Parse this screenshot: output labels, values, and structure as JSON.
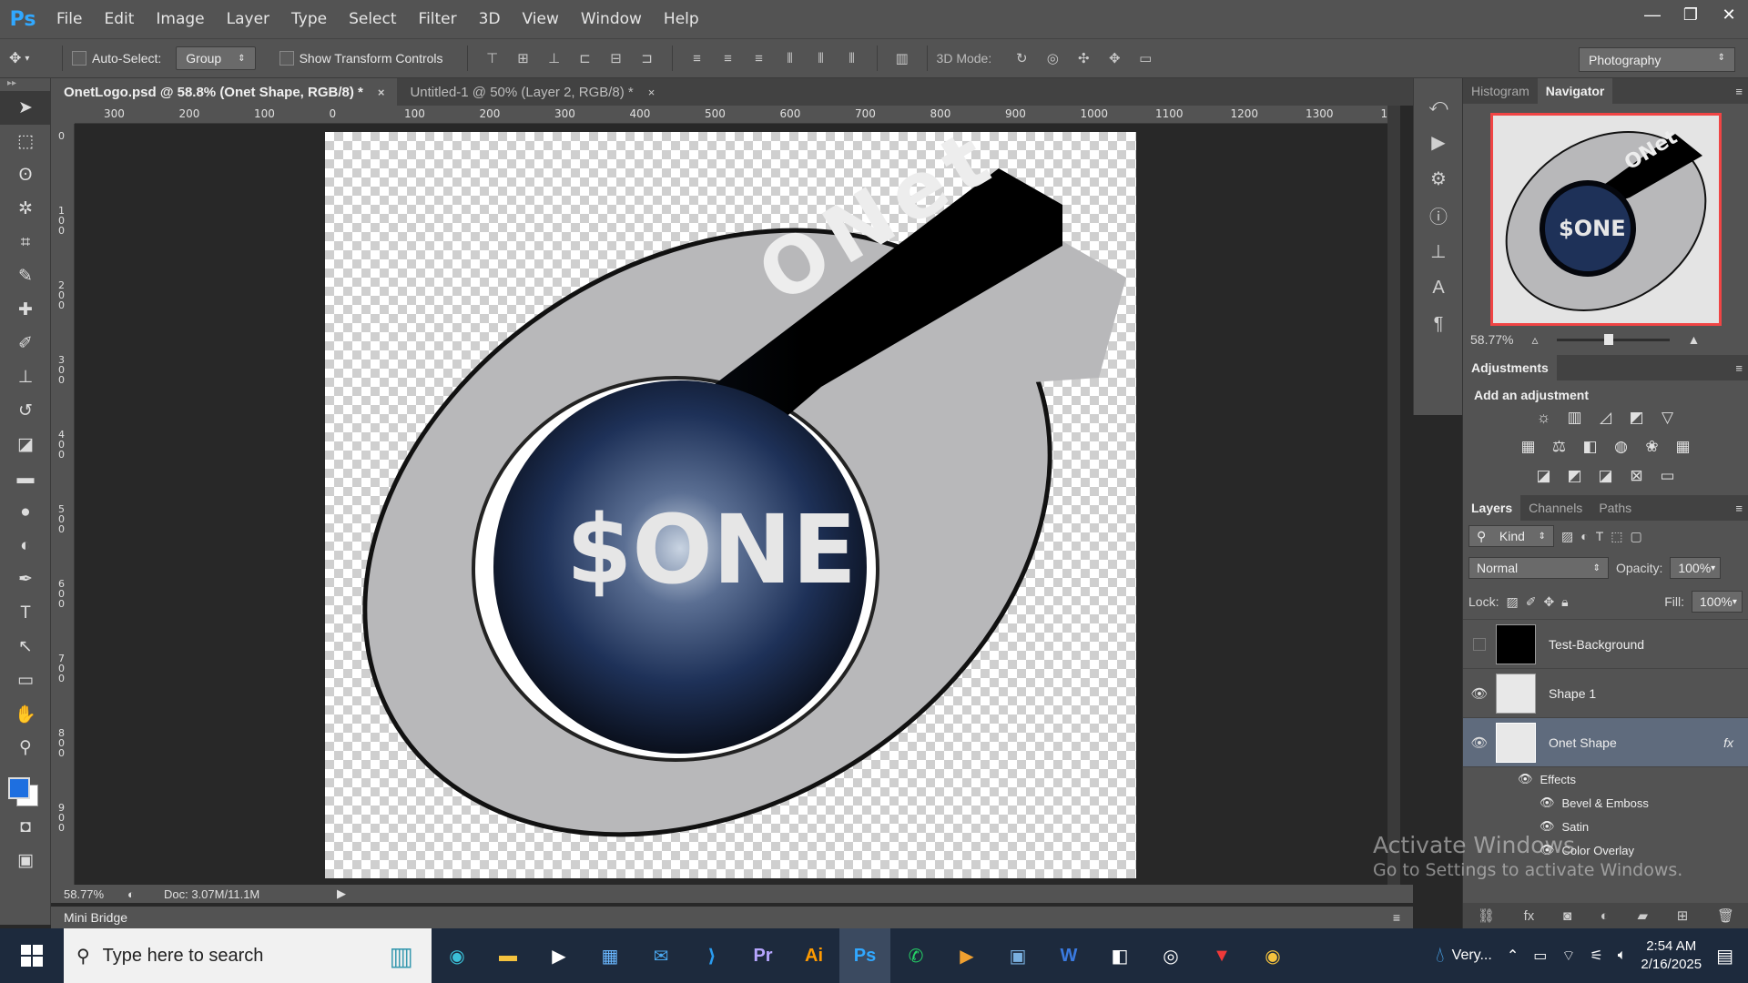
{
  "app": {
    "logo": "Ps"
  },
  "menu": [
    "File",
    "Edit",
    "Image",
    "Layer",
    "Type",
    "Select",
    "Filter",
    "3D",
    "View",
    "Window",
    "Help"
  ],
  "window_controls": {
    "minimize": "—",
    "restore": "❐",
    "close": "✕"
  },
  "options_bar": {
    "auto_select_label": "Auto-Select:",
    "auto_select_value": "Group",
    "transform_label": "Show Transform Controls",
    "mode3d_label": "3D Mode:",
    "workspace": "Photography"
  },
  "tabs": [
    {
      "label": "OnetLogo.psd @ 58.8% (Onet Shape, RGB/8) *",
      "close": "×"
    },
    {
      "label": "Untitled-1 @ 50% (Layer 2, RGB/8) *",
      "close": "×"
    }
  ],
  "ruler_h": [
    "300",
    "200",
    "100",
    "0",
    "100",
    "200",
    "300",
    "400",
    "500",
    "600",
    "700",
    "800",
    "900",
    "1000",
    "1100",
    "1200",
    "1300",
    "1"
  ],
  "ruler_v": [
    "0",
    "1\n0\n0",
    "2\n0\n0",
    "3\n0\n0",
    "4\n0\n0",
    "5\n0\n0",
    "6\n0\n0",
    "7\n0\n0",
    "8\n0\n0",
    "9\n0\n0"
  ],
  "artwork": {
    "ring_label": "ONet",
    "center_label": "$ONE"
  },
  "status": {
    "zoom": "58.77%",
    "doc": "Doc: 3.07M/11.1M"
  },
  "mini_bridge": "Mini Bridge",
  "navigator": {
    "tabs": [
      "Histogram",
      "Navigator"
    ],
    "zoom": "58.77%",
    "slider_fraction": 0.45
  },
  "adjustments": {
    "title": "Adjustments",
    "subtitle": "Add an adjustment"
  },
  "layers_panel": {
    "tabs": [
      "Layers",
      "Channels",
      "Paths"
    ],
    "kind": "Kind",
    "blend": "Normal",
    "opacity_label": "Opacity:",
    "opacity": "100%",
    "lock_label": "Lock:",
    "fill_label": "Fill:",
    "fill": "100%",
    "layers": [
      {
        "name": "Test-Background",
        "visible": false
      },
      {
        "name": "Shape 1",
        "visible": true
      },
      {
        "name": "Onet Shape",
        "visible": true,
        "fx": "fx"
      }
    ],
    "effects": [
      "Effects",
      "Bevel & Emboss",
      "Satin",
      "Color Overlay"
    ]
  },
  "watermark": {
    "line1": "Activate Windows",
    "line2": "Go to Settings to activate Windows."
  },
  "taskbar": {
    "search_placeholder": "Type here to search",
    "weather": "Very...",
    "time": "2:54 AM",
    "date": "2/16/2025",
    "apps": [
      "Pr",
      "Ai",
      "Ps",
      "W"
    ]
  },
  "colors": {
    "accent": "#31a8ff",
    "navigator_frame": "#f04444",
    "foreground": "#1e6fe0"
  }
}
